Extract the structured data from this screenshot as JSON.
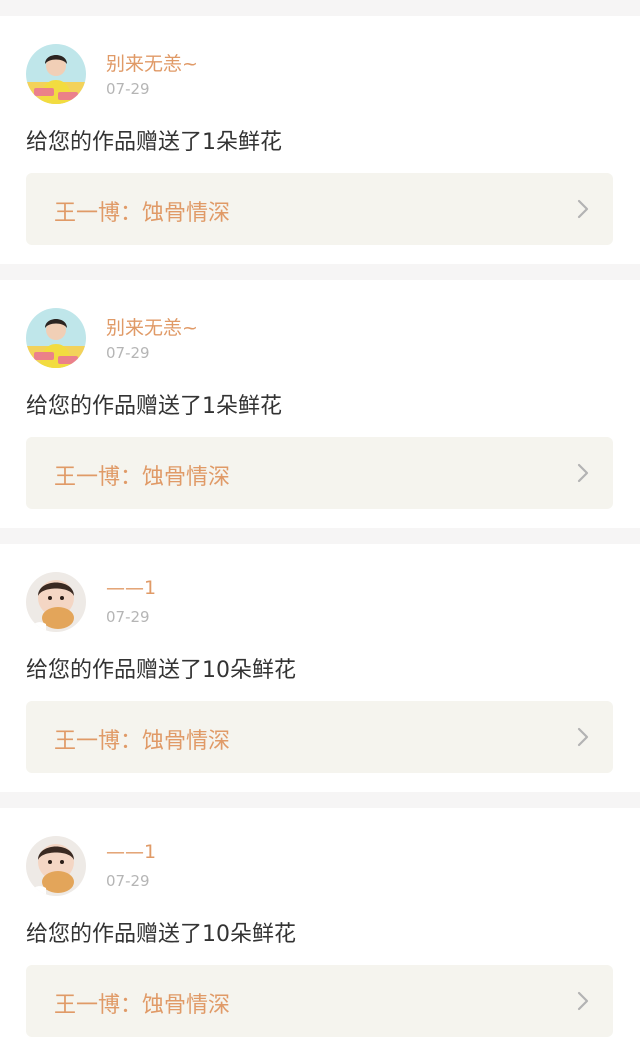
{
  "feed": [
    {
      "username": "别来无恙~",
      "date": "07-29",
      "message": "给您的作品赠送了1朵鲜花",
      "work_title": "王一博：蚀骨情深",
      "avatar_icon": "man-avatar-yellow"
    },
    {
      "username": "别来无恙~",
      "date": "07-29",
      "message": "给您的作品赠送了1朵鲜花",
      "work_title": "王一博：蚀骨情深",
      "avatar_icon": "man-avatar-yellow"
    },
    {
      "username": "——1",
      "date": "07-29",
      "message": "给您的作品赠送了10朵鲜花",
      "work_title": "王一博：蚀骨情深",
      "avatar_icon": "baby-avatar"
    },
    {
      "username": "——1",
      "date": "07-29",
      "message": "给您的作品赠送了10朵鲜花",
      "work_title": "王一博：蚀骨情深",
      "avatar_icon": "baby-avatar"
    }
  ],
  "colors": {
    "accent": "#e09a67",
    "page_background": "#f6f5f5",
    "link_card_background": "#f5f4ee",
    "date_text": "#b5b5b5",
    "message_text": "#333333"
  }
}
